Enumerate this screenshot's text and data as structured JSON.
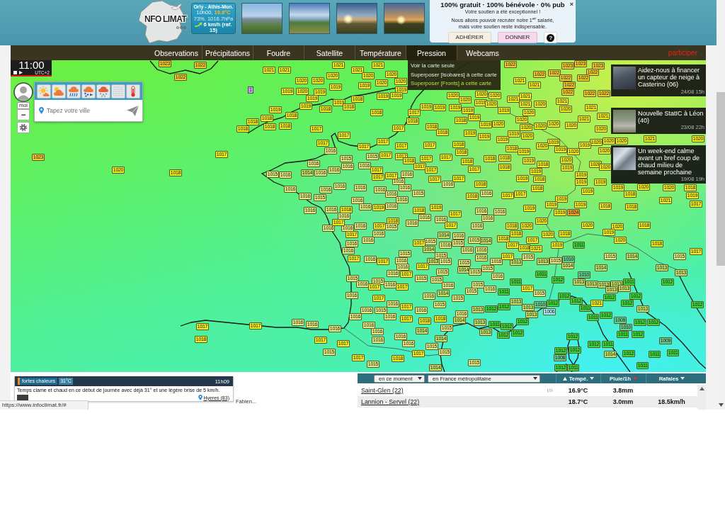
{
  "header": {
    "logo": {
      "text_left": "NFO",
      "text_right": "LIMAT"
    },
    "station": {
      "name": "Orly - Athis-Mon.",
      "time": "10h00,",
      "temperature": "19.8°C",
      "humidity_pressure": "73%, 1016.7hPa",
      "wind": "6 km/h (raf. 15)"
    },
    "donation": {
      "title": "100% gratuit · 100% bénévole · 0% pub",
      "close": "×",
      "message": "Votre soutien a été exceptionnel !\nNous allons pouvoir recruter notre 1$^{er}$ salarié,\nmais votre soutien reste indispensable.",
      "buttons": [
        {
          "label": "ADHÉRER",
          "kind": "join"
        },
        {
          "label": "DONNER",
          "kind": "donate"
        },
        {
          "label": "?",
          "kind": "help"
        }
      ]
    }
  },
  "nav": {
    "items": [
      {
        "label": "Observations",
        "selected": false
      },
      {
        "label": "Précipitations",
        "selected": false
      },
      {
        "label": "Foudre",
        "selected": false
      },
      {
        "label": "Satellite",
        "selected": false
      },
      {
        "label": "Température",
        "selected": false
      },
      {
        "label": "Pression",
        "selected": true
      },
      {
        "label": "Webcams",
        "selected": false
      }
    ],
    "participate": "participer"
  },
  "map": {
    "time": "11:00",
    "timezone": "UTC+2",
    "pression_menu": [
      {
        "label": "Voir la carte seule",
        "selected": false
      },
      {
        "label": "Superposer [Isobares] à cette carte",
        "selected": false
      },
      {
        "label": "Superposer [Fronts] à cette carte",
        "selected": true
      }
    ],
    "user_label": "moi",
    "zoom_out": "−",
    "city_search": {
      "placeholder": "Tapez votre ville"
    },
    "pin_label": "1",
    "news": [
      {
        "title": "Aidez-nous à financer un capteur de neige à Casterino (06)",
        "date": "24/08 15h"
      },
      {
        "title": "Nouvelle StatIC à Léon (40)",
        "date": "23/08 22h"
      },
      {
        "title": "Un week-end calme avant un bref coup de chaud milieu de semaine prochaine",
        "date": "19/08 19h"
      }
    ],
    "pressure_labels": [
      {
        "color": "#f4cc2c",
        "values": [
          "1023",
          "1022",
          "1022",
          "1023",
          "1023",
          "1023",
          "1022",
          "1022",
          "1022"
        ]
      },
      {
        "color": "#f2ee1e",
        "values": [
          "1021",
          "1021"
        ]
      },
      {
        "color": "#f2ee1e",
        "values": [
          "1021",
          "1021",
          "1020",
          "1021",
          "1020",
          "1020"
        ]
      },
      {
        "color": "#f4cc2c",
        "values": [
          "1022",
          "1022",
          "1022",
          "1022",
          "1022",
          "1022",
          "1022",
          "1023"
        ]
      },
      {
        "color": "#f2ee1e",
        "values": [
          "1020",
          "1020",
          "1020",
          "1020",
          "1021",
          "1021"
        ]
      },
      {
        "color": "#f2ee1e",
        "values": [
          "1019",
          "1020",
          "1019",
          "1019",
          "1019",
          "1019",
          "1019",
          "1018",
          "1019",
          "1019",
          "1020",
          "1020",
          "1020",
          "1020",
          "1021",
          "1021",
          "1021"
        ]
      },
      {
        "color": "#f2ee1e",
        "values": [
          "1019",
          "1018",
          "1019",
          "1018",
          "1019",
          "1019",
          "1019",
          "1019",
          "1019",
          "1020",
          "1019",
          "1021",
          "1020",
          "1020",
          "1021"
        ]
      },
      {
        "color": "#f2ee1e",
        "values": [
          "1019",
          "1018",
          "1018",
          "1018",
          "1017",
          "1019",
          "1020",
          "1021",
          "1021"
        ]
      },
      {
        "color": "#f2ee1e",
        "values": [
          "1018",
          "1018",
          "1018",
          "1018",
          "1018",
          "1018",
          "1019",
          "1020",
          "1020",
          "1020",
          "1020",
          "1020",
          "1020"
        ]
      },
      {
        "color": "#f2ee1e",
        "values": [
          "1018",
          "1017",
          "1017",
          "1017",
          "1018",
          "1019",
          "1019",
          "1020",
          "1020",
          "1017",
          "1017",
          "1018",
          "1019",
          "1019",
          "1019",
          "1020",
          "1020",
          "1020",
          "1021",
          "1020",
          "1017",
          "1017",
          "1017",
          "1018",
          "1018",
          "1019",
          "1020",
          "1019",
          "1020",
          "1019",
          "1020"
        ]
      },
      {
        "color": "#e4ec80",
        "values": [
          "1016",
          "1015",
          "1015"
        ]
      },
      {
        "color": "#f2ee1e",
        "values": [
          "1017",
          "1017",
          "1017",
          "1018",
          "1017",
          "1017",
          "1018",
          "1018",
          "1018",
          "1019",
          "1020",
          "1020",
          "1017",
          "1017",
          "1017",
          "1017",
          "1018",
          "1018",
          "1019",
          "1020",
          "1020"
        ]
      },
      {
        "color": "#e4ec80",
        "values": [
          "1016",
          "1016",
          "1016",
          "1016",
          "1015",
          "1016",
          "1016",
          "1016",
          "1016",
          "1016",
          "1016"
        ]
      },
      {
        "color": "#f2ee1e",
        "values": [
          "1018",
          "1017",
          "1017",
          "1017",
          "1019",
          "1019",
          "1019"
        ]
      },
      {
        "color": "#c2e06a",
        "values": [
          "1014",
          "1014",
          "1014",
          "1014",
          "1013",
          "1013",
          "1013",
          "1014",
          "1014",
          "1014",
          "1014",
          "1013",
          "1013",
          "1013",
          "1013",
          "1013",
          "1013",
          "1014",
          "1013",
          "1013",
          "1013",
          "1013",
          "1013",
          "1013",
          "1013",
          "1014",
          "1013",
          "1014",
          "1013"
        ]
      },
      {
        "color": "#f2ee1e",
        "values": [
          "1017",
          "1018",
          "1018",
          "1019",
          "1019",
          "1017",
          "1017",
          "1018",
          "1019",
          "1019",
          "1018",
          "1020",
          "1020",
          "1018",
          "1019"
        ]
      },
      {
        "color": "#e4ec80",
        "values": [
          "1016",
          "1016",
          "1016",
          "1016",
          "1016",
          "1016",
          "1015",
          "1016"
        ]
      },
      {
        "color": "#f2ee1e",
        "values": [
          "1018",
          "1019",
          "1021",
          "1017"
        ]
      },
      {
        "color": "#e4ec80",
        "values": [
          "1016",
          "1015",
          "1016",
          "1016",
          "1016",
          "1016",
          "1016",
          "1016",
          "1016",
          "1016"
        ]
      },
      {
        "color": "#f2ee1e",
        "values": [
          "1018",
          "1019",
          "1018",
          "1019",
          "1019",
          "1019",
          "1019",
          "1019",
          "1018",
          "1018",
          "1018",
          "1017",
          "1020"
        ]
      },
      {
        "color": "#f39c2a",
        "values": [
          "1024"
        ]
      },
      {
        "color": "#e4ec80",
        "values": [
          "1016",
          "1016",
          "1016",
          "1016",
          "1016",
          "1016",
          "1016",
          "1015",
          "1016",
          "1016",
          "1016",
          "1016",
          "1016",
          "1016",
          "1015",
          "1016",
          "1015",
          "1015",
          "1016",
          "1015",
          "1016",
          "1016",
          "1016",
          "1016",
          "1015",
          "1015",
          "1015",
          "1016",
          "1016",
          "1015",
          "1015",
          "1015",
          "1015",
          "1016",
          "1015",
          "1015",
          "1015",
          "1015",
          "1016",
          "1015",
          "1015",
          "1016",
          "1016",
          "1015",
          "1016",
          "1016",
          "1015",
          "1016"
        ]
      },
      {
        "color": "#f2ee1e",
        "values": [
          "1017",
          "1017",
          "1017",
          "1018",
          "1020",
          "1020",
          "1020",
          "1018",
          "1017",
          "1018",
          "1020",
          "1018",
          "1019",
          "1017",
          "1018",
          "1017",
          "1017",
          "1019",
          "1020",
          "1018"
        ]
      },
      {
        "color": "#3fd83c",
        "values": [
          "1011",
          "1011",
          "1011",
          "1012",
          "1011",
          "1012",
          "1011",
          "1012",
          "1012",
          "1012",
          "1012",
          "1012",
          "1012",
          "1012",
          "1011",
          "1012",
          "1012",
          "1012",
          "1011",
          "1012",
          "1012",
          "1012"
        ]
      },
      {
        "color": "#f2ee1e",
        "values": [
          "1018",
          "1021",
          "1017"
        ]
      },
      {
        "color": "#f2ee1e",
        "values": [
          "1017",
          "1017",
          "1017",
          "1017",
          "1017",
          "1017",
          "1017",
          "1017",
          "1017",
          "1021"
        ]
      },
      {
        "color": "#66d092",
        "values": [
          "1010",
          "1010",
          "1010",
          "1009",
          "1010",
          "1009",
          "1008"
        ]
      },
      {
        "color": "#e4ec80",
        "values": [
          "1016",
          "1016",
          "1015",
          "1015",
          "1015",
          "1016",
          "1015"
        ]
      },
      {
        "color": "#f2ee1e",
        "values": [
          "1017",
          "1017",
          "1018",
          "1018",
          "1017",
          "1017",
          "1018",
          "1017",
          "1017",
          "1017"
        ]
      },
      {
        "color": "#e4ec80",
        "values": [
          "1016",
          "1015",
          "1016",
          "1016",
          "1016",
          "1016",
          "1016",
          "1016",
          "1016",
          "1016",
          "1016",
          "1015",
          "1016",
          "1016",
          "1016",
          "1015"
        ]
      },
      {
        "color": "#aee9f5",
        "values": [
          "1006"
        ]
      },
      {
        "color": "#3fd83c",
        "values": [
          "1011",
          "1012",
          "1012",
          "1011"
        ]
      },
      {
        "color": "#3fd83c",
        "values": [
          "1012",
          "1012",
          "1012",
          "1012",
          "1011"
        ]
      },
      {
        "color": "#c2e06a",
        "values": [
          "1014",
          "1014",
          "1014"
        ]
      },
      {
        "color": "#e4ec80",
        "values": [
          "1015",
          "1015",
          "1015",
          "1015"
        ]
      },
      {
        "color": "#f2ee1e",
        "values": [
          "1017",
          "1018"
        ]
      },
      {
        "color": "#3fd83c",
        "values": [
          "1012",
          "1012",
          "1012",
          "1011",
          "1011",
          "1011"
        ]
      },
      {
        "color": "#3fd83c",
        "values": [
          "1012",
          "1011"
        ]
      }
    ]
  },
  "observation_popup": {
    "tag": "fortes chaleurs",
    "tag_temperature": "31°C",
    "time": "11h09",
    "text": "Temps clame et chaud en ce début de journée avec déjà 31° et une légère brise de 5 km/h.",
    "location": "Hyeres (83)",
    "author": "Fabien..."
  },
  "observations_table": {
    "filters": [
      "en ce moment",
      "en France métropolitaine"
    ],
    "columns": [
      {
        "label": "Tempé.",
        "sorted": true,
        "highlighted": false
      },
      {
        "label": "Pluie/1h",
        "sorted": false,
        "highlighted": true
      },
      {
        "label": "Rafales",
        "sorted": false,
        "highlighted": false
      }
    ],
    "rows": [
      {
        "station": "Saint-Glen (22)",
        "weather_icon": true,
        "temperature": "16.9°C",
        "rain": "3.8mm"
      },
      {
        "station": "Lannion - Servel (22)",
        "weather_icon": false,
        "temperature": "18.7°C",
        "rain": "3.0mm",
        "gusts": "18.5km/h"
      }
    ]
  },
  "status_url": "https://www.infoclimat.fr/#"
}
